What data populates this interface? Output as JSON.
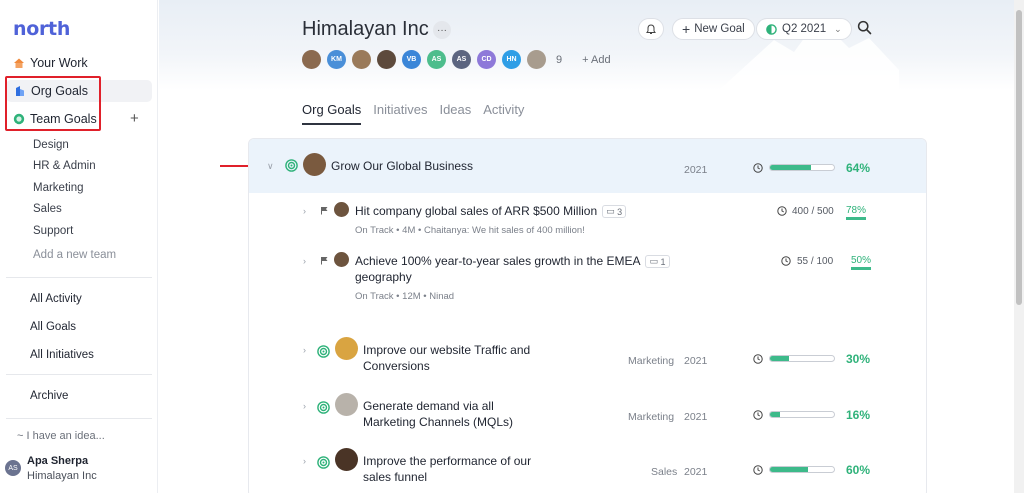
{
  "app": {
    "logo": "north"
  },
  "sidebar": {
    "your_work": "Your Work",
    "org_goals": "Org Goals",
    "team_goals": "Team Goals",
    "teams": [
      "Design",
      "HR & Admin",
      "Marketing",
      "Sales",
      "Support"
    ],
    "add_team": "Add a new team",
    "all_activity": "All Activity",
    "all_goals": "All Goals",
    "all_initiatives": "All Initiatives",
    "archive": "Archive",
    "idea": "~ I have an idea...",
    "user": {
      "initials": "AS",
      "name": "Apa Sherpa",
      "org": "Himalayan Inc"
    }
  },
  "header": {
    "title": "Himalayan Inc",
    "more": "···",
    "members": [
      {
        "initials": "",
        "color": "#8b6a4f"
      },
      {
        "initials": "KM",
        "color": "#4a8fd8"
      },
      {
        "initials": "",
        "color": "#9a7a5a"
      },
      {
        "initials": "",
        "color": "#5d4a3c"
      },
      {
        "initials": "VB",
        "color": "#3b86d8"
      },
      {
        "initials": "AS",
        "color": "#4dbd8c"
      },
      {
        "initials": "AS",
        "color": "#5c6580"
      },
      {
        "initials": "CD",
        "color": "#8e79d9"
      },
      {
        "initials": "HN",
        "color": "#2f9ee6"
      },
      {
        "initials": "",
        "color": "#a89c8e"
      }
    ],
    "member_count": "9",
    "add_label": "+ Add",
    "new_goal": "New Goal",
    "quarter": "Q2 2021"
  },
  "tabs": [
    "Org Goals",
    "Initiatives",
    "Ideas",
    "Activity"
  ],
  "main_goal": {
    "name": "Grow Our Global Business",
    "year": "2021",
    "progress": 64,
    "percent": "64%"
  },
  "key_results": [
    {
      "name": "Hit company global sales of ARR $500 Million",
      "comments": "3",
      "status": "On Track",
      "age": "4M",
      "note": "Chaitanya: We hit sales of 400 million!",
      "value": "400 / 500",
      "percent": "78%"
    },
    {
      "name": "Achieve 100% year-to-year sales growth in the EMEA geography",
      "name_line1": "Achieve 100% year-to-year sales growth in the EMEA",
      "name_line2": "geography",
      "comments": "1",
      "status": "On Track",
      "age": "12M",
      "note": "Ninad",
      "value": "55 / 100",
      "percent": "50%"
    }
  ],
  "child_goals": [
    {
      "line1": "Improve our website Traffic and",
      "line2": "Conversions",
      "team": "Marketing",
      "year": "2021",
      "progress": 30,
      "percent": "30%"
    },
    {
      "line1": "Generate demand via all",
      "line2": "Marketing Channels (MQLs)",
      "team": "Marketing",
      "year": "2021",
      "progress": 16,
      "percent": "16%"
    },
    {
      "line1": "Improve the performance of our",
      "line2": "sales funnel",
      "team": "Sales",
      "year": "2021",
      "progress": 60,
      "percent": "60%"
    }
  ],
  "colors": {
    "accent": "#4f62d8",
    "progress": "#3dba8a",
    "highlight": "#e0202a"
  }
}
